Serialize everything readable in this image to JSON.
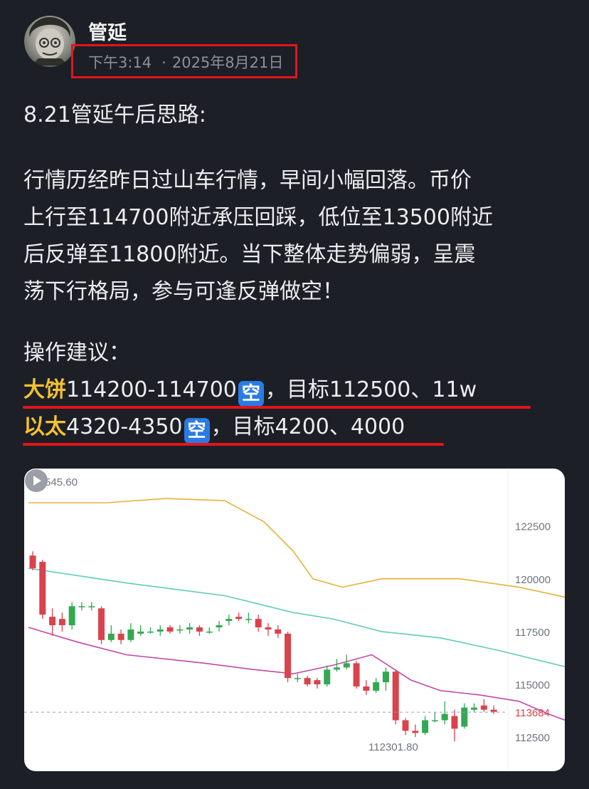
{
  "post": {
    "author": "管延",
    "time": "下午3:14",
    "date": "2025年8月21日",
    "title": "8.21管延午后思路:",
    "body_lines": [
      "行情历经昨日过山车行情，早间小幅回落。币价",
      "上行至114700附近承压回踩，低位至13500附近",
      "后反弹至11800附近。当下整体走势偏弱，呈震",
      "荡下行格局，参与可逢反弹做空！"
    ],
    "advice_heading": "操作建议：",
    "advice": [
      {
        "asset": "大饼",
        "range": "114200-114700",
        "badge": "空",
        "target": "，目标112500、11w"
      },
      {
        "asset": "以太",
        "range": "4320-4350",
        "badge": "空",
        "target": "，目标4200、4000"
      }
    ]
  },
  "colors": {
    "background": "#1c1f26",
    "highlight": "#f5c22e",
    "annotation_red": "#e3151b",
    "badge_blue": "#2a7be4",
    "candle_up": "#33a852",
    "candle_down": "#d9434c",
    "upper_band": "#e8b13a",
    "middle_band": "#5fcdb3",
    "lower_band": "#c448a8"
  },
  "icons": [
    "avatar",
    "expand-icon",
    "play-icon"
  ],
  "chart_data": {
    "type": "candlestick",
    "y_ticks": [
      "122500",
      "120000",
      "117500",
      "115000",
      "112500"
    ],
    "y_values": [
      122500,
      120000,
      117500,
      115000,
      112500
    ],
    "ylim": [
      111700,
      124545.6
    ],
    "max_label": "124545.60",
    "min_label": "112301.80",
    "last_price_label": "113684",
    "last_price": 113684,
    "candles": [
      [
        121100,
        120500,
        121300,
        120400
      ],
      [
        120800,
        118300,
        120900,
        118100
      ],
      [
        118200,
        117800,
        118600,
        117300
      ],
      [
        118100,
        117800,
        118400,
        117500
      ],
      [
        117800,
        118700,
        118900,
        117600
      ],
      [
        118700,
        118700,
        118900,
        118500
      ],
      [
        118700,
        118700,
        118900,
        118500
      ],
      [
        118600,
        117100,
        118700,
        116900
      ],
      [
        117100,
        117400,
        117800,
        117000
      ],
      [
        117400,
        117100,
        117600,
        116900
      ],
      [
        117100,
        117600,
        117900,
        117000
      ],
      [
        117400,
        117500,
        117800,
        117300
      ],
      [
        117500,
        117500,
        117700,
        117400
      ],
      [
        117500,
        117600,
        117800,
        117300
      ],
      [
        117700,
        117500,
        117800,
        117400
      ],
      [
        117600,
        117600,
        117800,
        117400
      ],
      [
        117600,
        117700,
        117900,
        117400
      ],
      [
        117700,
        117500,
        117800,
        117300
      ],
      [
        117500,
        117500,
        117700,
        117400
      ],
      [
        117700,
        117800,
        118000,
        117500
      ],
      [
        118000,
        118100,
        118300,
        117800
      ],
      [
        118200,
        118100,
        118400,
        118000
      ],
      [
        118100,
        118100,
        118400,
        117900
      ],
      [
        118100,
        117700,
        118300,
        117500
      ],
      [
        117700,
        117600,
        117900,
        117300
      ],
      [
        117600,
        117400,
        117800,
        117200
      ],
      [
        117400,
        115300,
        117500,
        115100
      ],
      [
        115300,
        115300,
        115500,
        115100
      ],
      [
        115300,
        115000,
        115400,
        114900
      ],
      [
        115200,
        115000,
        115300,
        114800
      ],
      [
        115000,
        115700,
        115900,
        114900
      ],
      [
        115700,
        115800,
        116200,
        115600
      ],
      [
        115800,
        116000,
        116400,
        115700
      ],
      [
        116000,
        114900,
        116100,
        114800
      ],
      [
        114900,
        114700,
        115200,
        114500
      ],
      [
        114700,
        115100,
        115300,
        114600
      ],
      [
        115100,
        115600,
        115800,
        114700
      ],
      [
        115600,
        113300,
        115700,
        113100
      ],
      [
        113300,
        112800,
        113400,
        112600
      ],
      [
        112800,
        112700,
        113100,
        112500
      ],
      [
        112700,
        113300,
        113500,
        112600
      ],
      [
        113300,
        113300,
        113700,
        113200
      ],
      [
        113300,
        113600,
        114200,
        113100
      ],
      [
        113500,
        112900,
        113800,
        112301.8
      ],
      [
        113000,
        113900,
        114100,
        112900
      ],
      [
        113800,
        113900,
        114100,
        113700
      ],
      [
        114000,
        113800,
        114300,
        113700
      ],
      [
        113800,
        113700,
        114000,
        113600
      ]
    ],
    "upper_band": [
      [
        0,
        123600
      ],
      [
        8,
        123600
      ],
      [
        14,
        123800
      ],
      [
        20,
        123700
      ],
      [
        24,
        122700
      ],
      [
        27,
        121300
      ],
      [
        29,
        120000
      ],
      [
        32,
        119600
      ],
      [
        36,
        120000
      ],
      [
        40,
        120000
      ],
      [
        44,
        120000
      ],
      [
        50,
        119600
      ],
      [
        57,
        118900
      ],
      [
        64,
        117000
      ],
      [
        69,
        115600
      ]
    ],
    "middle_band": [
      [
        0,
        120500
      ],
      [
        10,
        119800
      ],
      [
        20,
        119200
      ],
      [
        27,
        118400
      ],
      [
        31,
        118100
      ],
      [
        36,
        117500
      ],
      [
        42,
        117200
      ],
      [
        48,
        116600
      ],
      [
        55,
        115800
      ],
      [
        62,
        115000
      ],
      [
        69,
        114300
      ]
    ],
    "lower_band": [
      [
        0,
        117700
      ],
      [
        5,
        117000
      ],
      [
        10,
        116400
      ],
      [
        18,
        116000
      ],
      [
        23,
        115700
      ],
      [
        27,
        115500
      ],
      [
        31,
        115900
      ],
      [
        35,
        116400
      ],
      [
        39,
        115200
      ],
      [
        42,
        114700
      ],
      [
        46,
        114500
      ],
      [
        50,
        114200
      ],
      [
        53,
        113600
      ],
      [
        57,
        112900
      ],
      [
        60,
        112400
      ],
      [
        63,
        112300
      ],
      [
        66,
        112500
      ],
      [
        69,
        112800
      ]
    ]
  }
}
